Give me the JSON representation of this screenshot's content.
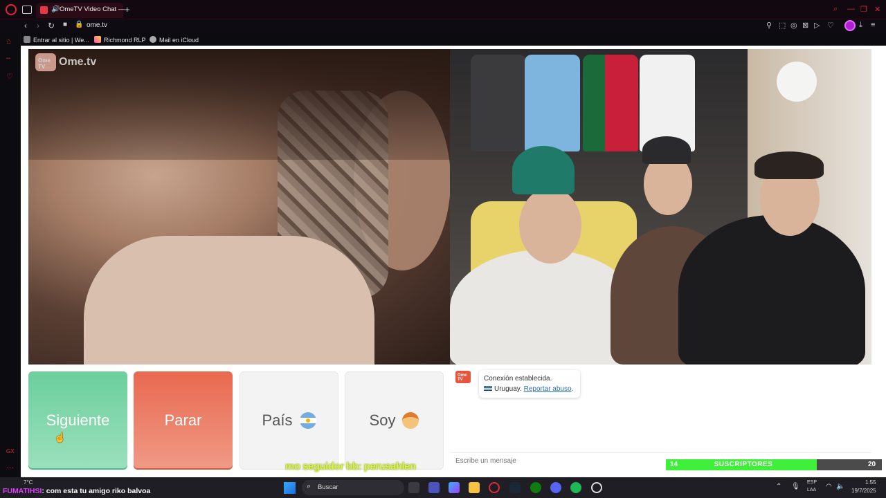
{
  "browser": {
    "tab_title": "OmeTV Video Chat —",
    "url": "ome.tv",
    "new_tab": "+",
    "bookmarks": [
      {
        "label": "Entrar al sitio | We..."
      },
      {
        "label": "Richmond RLP"
      },
      {
        "label": "Mail en iCloud"
      }
    ]
  },
  "page": {
    "logo_text": "Ome.tv",
    "logo_badge": "Ome TV",
    "buttons": {
      "next": "Siguiente",
      "stop": "Parar",
      "country": "País",
      "gender": "Soy"
    },
    "chat": {
      "status": "Conexión establecida.",
      "country": "Uruguay.",
      "report": "Reportar abuso",
      "report_suffix": ".",
      "input_placeholder": "Escribe un mensaje"
    }
  },
  "overlay": {
    "follower_text": "mo seguidor bb: perusahlen",
    "subs_count": "14",
    "subs_label": "SUSCRIPTORES",
    "subs_goal": "20",
    "subs_progress": 0.7
  },
  "taskbar": {
    "weather": "7°C",
    "stream_user": "FUMATIHSI",
    "stream_message": ": com esta tu amigo riko balvoa",
    "search_label": "Buscar",
    "lang_1": "ESP",
    "lang_2": "LAA",
    "time": "1:55",
    "date": "19/7/2025"
  },
  "colors": {
    "next": "#6ccf9c",
    "stop": "#e8694f",
    "subs_fill": "#3ff03a",
    "browser_accent": "#e0283a"
  }
}
